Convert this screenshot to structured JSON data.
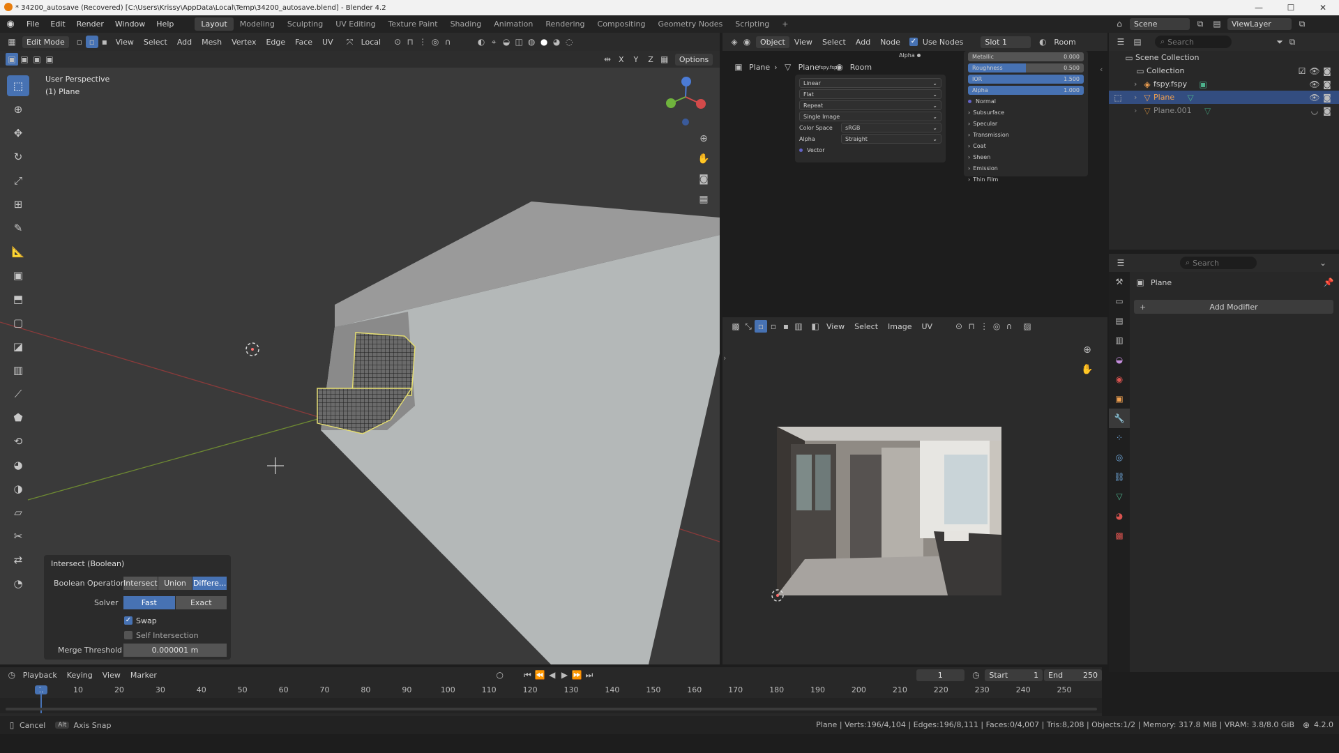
{
  "title_bar": {
    "text": "* 34200_autosave (Recovered) [C:\\Users\\Krissy\\AppData\\Local\\Temp\\34200_autosave.blend] - Blender 4.2"
  },
  "menus": [
    "File",
    "Edit",
    "Render",
    "Window",
    "Help"
  ],
  "workspaces": [
    "Layout",
    "Modeling",
    "Sculpting",
    "UV Editing",
    "Texture Paint",
    "Shading",
    "Animation",
    "Rendering",
    "Compositing",
    "Geometry Nodes",
    "Scripting"
  ],
  "scene": "Scene",
  "view_layer": "ViewLayer",
  "viewport": {
    "mode": "Edit Mode",
    "menu": [
      "View",
      "Select",
      "Add",
      "Mesh",
      "Vertex",
      "Edge",
      "Face",
      "UV"
    ],
    "orientation": "Local",
    "options": "Options",
    "axes": [
      "X",
      "Y",
      "Z"
    ],
    "info_line1": "User Perspective",
    "info_line2": "(1) Plane"
  },
  "operator_panel": {
    "title": "Intersect (Boolean)",
    "op_label": "Boolean Operation",
    "ops": [
      "Intersect",
      "Union",
      "Differe..."
    ],
    "solver_label": "Solver",
    "solvers": [
      "Fast",
      "Exact"
    ],
    "swap": "Swap",
    "self_intersection": "Self Intersection",
    "merge_label": "Merge Threshold",
    "merge_value": "0.000001 m"
  },
  "node_editor": {
    "object": "Object",
    "menu": [
      "View",
      "Select",
      "Add",
      "Node"
    ],
    "use_nodes": "Use Nodes",
    "slot": "Slot 1",
    "world": "Room",
    "crumb_plane": "Plane",
    "crumb_mesh": "Plane",
    "crumb_mat": "Room",
    "mesh_small": "fspy.fspy",
    "alpha_label": "Alpha",
    "tex": {
      "interp": "Linear",
      "proj": "Flat",
      "ext": "Repeat",
      "src": "Single Image",
      "cs_label": "Color Space",
      "cs_val": "sRGB",
      "al_label": "Alpha",
      "al_val": "Straight",
      "vector": "Vector"
    },
    "bsdf": {
      "metallic_label": "Metallic",
      "metallic": "0.000",
      "rough_label": "Roughness",
      "rough": "0.500",
      "rough_frac": 0.5,
      "ior_label": "IOR",
      "ior": "1.500",
      "alpha_label": "Alpha",
      "alpha": "1.000",
      "normal": "Normal",
      "sections": [
        "Subsurface",
        "Specular",
        "Transmission",
        "Coat",
        "Sheen",
        "Emission",
        "Thin Film"
      ]
    }
  },
  "image_editor": {
    "menu": [
      "View",
      "Select",
      "Image",
      "UV"
    ]
  },
  "outliner": {
    "search": "Search",
    "root": "Scene Collection",
    "collection": "Collection",
    "items": [
      "fspy.fspy",
      "Plane",
      "Plane.001"
    ]
  },
  "properties": {
    "search": "Search",
    "object": "Plane",
    "add_modifier": "Add Modifier"
  },
  "timeline": {
    "menu": [
      "Playback",
      "Keying",
      "View",
      "Marker"
    ],
    "current": "1",
    "start_label": "Start",
    "start": "1",
    "end_label": "End",
    "end": "250",
    "ticks": [
      "1",
      "10",
      "20",
      "30",
      "40",
      "50",
      "60",
      "70",
      "80",
      "90",
      "100",
      "110",
      "120",
      "130",
      "140",
      "150",
      "160",
      "170",
      "180",
      "190",
      "200",
      "210",
      "220",
      "230",
      "240",
      "250"
    ]
  },
  "status": {
    "cancel": "Cancel",
    "alt": "Alt",
    "axis_snap": "Axis Snap",
    "stats": "Plane | Verts:196/4,104 | Edges:196/8,111 | Faces:0/4,007 | Tris:8,208 | Objects:1/2 | Memory: 317.8 MiB | VRAM: 3.8/8.0 GiB",
    "version": "4.2.0"
  },
  "colors": {
    "accent": "#4772b3",
    "selected_orange": "#f0a050",
    "edit_outline": "#e8e070"
  }
}
